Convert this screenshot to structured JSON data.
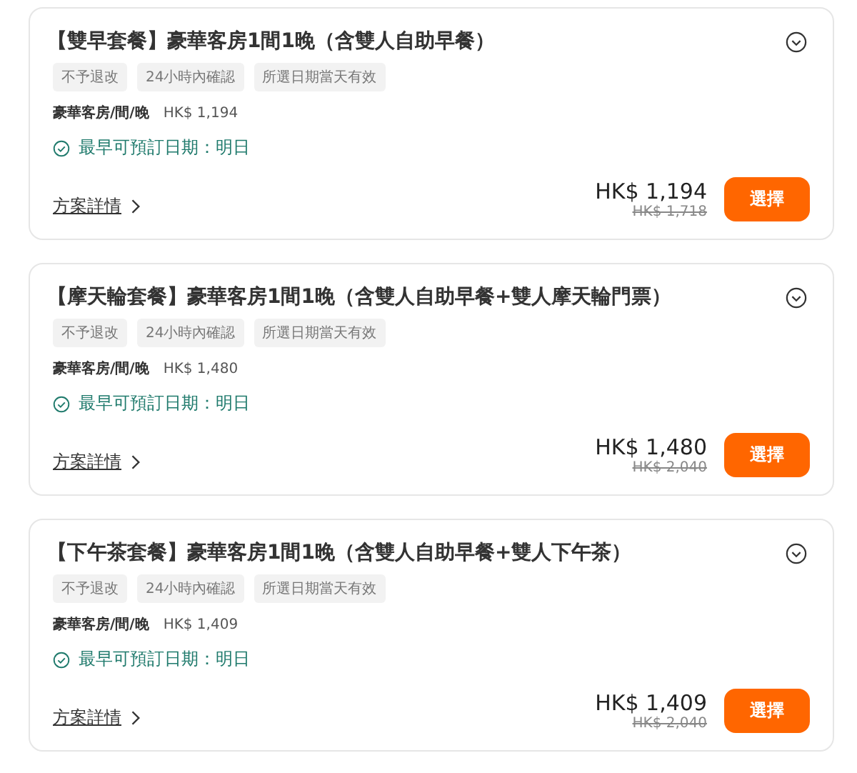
{
  "packages": [
    {
      "title": "【雙早套餐】豪華客房1間1晚（含雙人自助早餐）",
      "tags": [
        "不予退改",
        "24小時內確認",
        "所選日期當天有效"
      ],
      "room_label": "豪華客房/間/晚",
      "room_price": "HK$ 1,194",
      "availability": "最早可預訂日期：明日",
      "details_link": "方案詳情",
      "price": "HK$ 1,194",
      "original_price": "HK$ 1,718",
      "button": "選擇"
    },
    {
      "title": "【摩天輪套餐】豪華客房1間1晚（含雙人自助早餐+雙人摩天輪門票）",
      "tags": [
        "不予退改",
        "24小時內確認",
        "所選日期當天有效"
      ],
      "room_label": "豪華客房/間/晚",
      "room_price": "HK$ 1,480",
      "availability": "最早可預訂日期：明日",
      "details_link": "方案詳情",
      "price": "HK$ 1,480",
      "original_price": "HK$ 2,040",
      "button": "選擇"
    },
    {
      "title": "【下午茶套餐】豪華客房1間1晚（含雙人自助早餐+雙人下午茶）",
      "tags": [
        "不予退改",
        "24小時內確認",
        "所選日期當天有效"
      ],
      "room_label": "豪華客房/間/晚",
      "room_price": "HK$ 1,409",
      "availability": "最早可預訂日期：明日",
      "details_link": "方案詳情",
      "price": "HK$ 1,409",
      "original_price": "HK$ 2,040",
      "button": "選擇"
    }
  ]
}
